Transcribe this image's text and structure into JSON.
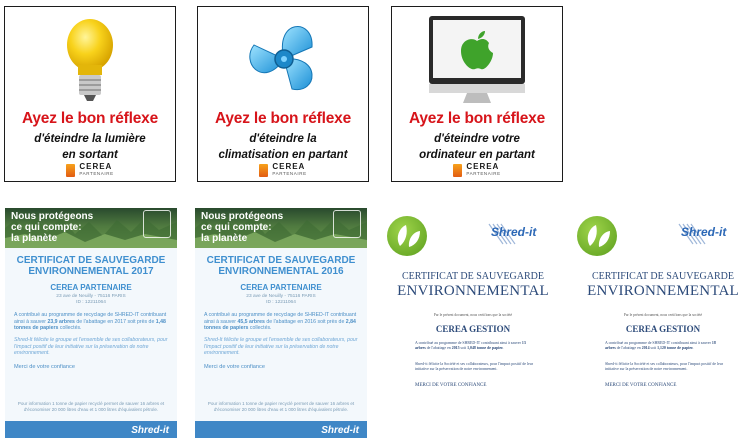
{
  "posters": [
    {
      "headline": "Ayez le bon réflexe",
      "line1": "d'éteindre la lumière",
      "line2": "en sortant",
      "brand": "CEREA",
      "brand_tag": "PARTENAIRE",
      "icon": "light-bulb-icon"
    },
    {
      "headline": "Ayez le bon réflexe",
      "line1": "d'éteindre la",
      "line2": "climatisation en partant",
      "brand": "CEREA",
      "brand_tag": "PARTENAIRE",
      "icon": "fan-icon"
    },
    {
      "headline": "Ayez le bon réflexe",
      "line1": "d'éteindre votre",
      "line2": "ordinateur en partant",
      "brand": "CEREA",
      "brand_tag": "PARTENAIRE",
      "icon": "computer-icon"
    }
  ],
  "blue_certs": [
    {
      "slogan_1": "Nous protégeons",
      "slogan_2": "ce qui compte:",
      "slogan_3": "la planète",
      "title_1": "CERTIFICAT DE SAUVEGARDE",
      "title_2": "ENVIRONNEMENTAL 2017",
      "org": "CEREA PARTENAIRE",
      "addr_1": "23 ave de Neuilly - 75116 PARIS",
      "addr_2": "ID : 12211064",
      "body_a": "A contribué au programme de recyclage de SHRED-IT contribuant ainsi à sauver",
      "body_b": "23,9 arbres",
      "body_c": "de l'abattage en 2017 soit près de",
      "body_d": "1,48 tonnes de papiers",
      "body_e": "collectés.",
      "body2": "Shred-It félicite le groupe et l'ensemble de ses collaborateurs, pour l'impact positif de leur initiative sur la préservation de notre environnement.",
      "thanks": "Merci de votre confiance",
      "foot_1": "Pour information 1 tonne de papier recyclé permet de sauver 16 arbres et",
      "foot_2": "d'économiser 20 000 litres d'eau et 1 000 litres d'équivalent pétrole.",
      "brand": "Shred-it"
    },
    {
      "slogan_1": "Nous protégeons",
      "slogan_2": "ce qui compte:",
      "slogan_3": "la planète",
      "title_1": "CERTIFICAT DE SAUVEGARDE",
      "title_2": "ENVIRONNEMENTAL 2016",
      "org": "CEREA PARTENAIRE",
      "addr_1": "23 ave de Neuilly - 75116 PARIS",
      "addr_2": "ID : 12211064",
      "body_a": "A contribué au programme de recyclage de SHRED-IT contribuant ainsi à sauver",
      "body_b": "45,5 arbres",
      "body_c": "de l'abattage en 2016 soit près de",
      "body_d": "2,84 tonnes de papiers",
      "body_e": "collectés.",
      "body2": "Shred-It félicite le groupe et l'ensemble de ses collaborateurs, pour l'impact positif de leur initiative sur la préservation de notre environnement.",
      "thanks": "Merci de votre confiance",
      "foot_1": "Pour information 1 tonne de papier recyclé permet de sauver 16 arbres et",
      "foot_2": "d'économiser 20 000 litres d'eau et 1 000 litres d'équivalent pétrole.",
      "brand": "Shred-it"
    }
  ],
  "white_certs": [
    {
      "brand": "Shred-it",
      "title_1": "CERTIFICAT DE SAUVEGARDE",
      "title_2": "ENVIRONNEMENTAL",
      "intro": "Par le présent document, nous certifions que la société",
      "org": "CEREA GESTION",
      "p1a": "A contribué au programme de SHRED-IT contribuant ainsi à sauver",
      "p1b": "13 arbres",
      "p1c": "de l'abattage en",
      "p1d": "2015",
      "p1e": "soit",
      "p1f": "1,048 tonne de papier.",
      "p2": "Shred-it félicite la Société et ses collaborateurs, pour l'impact positif de leur initiative sur la préservation de notre environnement.",
      "thanks": "MERCI DE VOTRE CONFIANCE"
    },
    {
      "brand": "Shred-it",
      "title_1": "CERTIFICAT DE SAUVEGARDE",
      "title_2": "ENVIRONNEMENTAL",
      "intro": "Par le présent document, nous certifions que la société",
      "org": "CEREA GESTION",
      "p1a": "A contribué au programme de SHRED-IT contribuant ainsi à sauver",
      "p1b": "18 arbres",
      "p1c": "de l'abattage en",
      "p1d": "2014",
      "p1e": "soit",
      "p1f": "1,120 tonne de papier.",
      "p2": "Shred-it félicite la Société et ses collaborateurs, pour l'impact positif de leur initiative sur la préservation de notre environnement.",
      "thanks": "MERCI DE VOTRE CONFIANCE"
    }
  ]
}
